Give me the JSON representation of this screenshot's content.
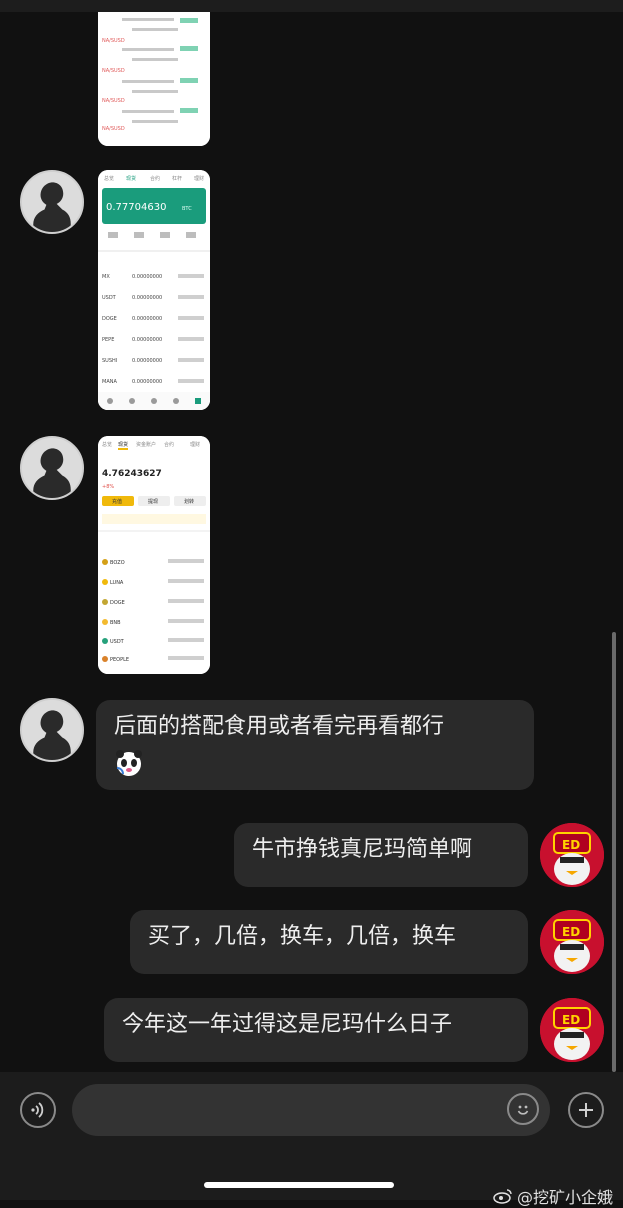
{
  "messages": {
    "incoming_text": "后面的搭配食用或者看完再看都行",
    "outgoing": [
      "牛市挣钱真尼玛简单啊",
      "买了，几倍，换车，几倍，换车",
      "今年这一年过得这是尼玛什么日子"
    ]
  },
  "shot1": {
    "items": [
      "NA/SUSD",
      "NA/SUSD",
      "NA/SUSD",
      "NA/SUSD"
    ]
  },
  "shot2": {
    "tabs": [
      "总览",
      "现货",
      "合约",
      "杠杆",
      "理财"
    ],
    "balance": "0.77704630",
    "balance_unit": "BTC",
    "coins": [
      "MX",
      "USDT",
      "DOGE",
      "PEPE",
      "SUSHI",
      "MANA"
    ],
    "values": [
      "0.00000000",
      "0.00000000",
      "0.00000000",
      "0.00000000",
      "0.00000000",
      "0.00000000"
    ]
  },
  "shot3": {
    "tabs": [
      "总览",
      "现货",
      "资金账户",
      "合约",
      "理财"
    ],
    "balance": "4.76243627",
    "pnl": "+8%",
    "buttons": [
      "充值",
      "提现",
      "划转"
    ],
    "coins": [
      "BOZO",
      "LUNA",
      "DOGE",
      "BNB",
      "USDT",
      "PEOPLE"
    ]
  },
  "input": {
    "placeholder": ""
  },
  "watermark": {
    "text": "@挖矿小企娥"
  },
  "icons": {
    "voice": "voice-icon",
    "emoji": "emoji-icon",
    "plus": "plus-icon",
    "weibo": "weibo-icon"
  },
  "colors": {
    "background": "#111111",
    "bubble": "#2a2a2a",
    "accent_green": "#1a9c7c",
    "avatar_red": "#c8102e"
  }
}
